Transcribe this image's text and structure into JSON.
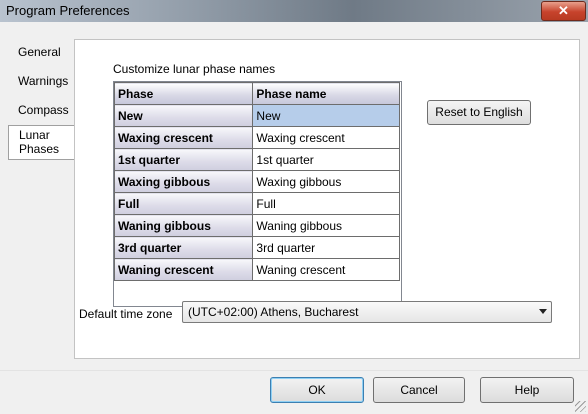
{
  "window": {
    "title": "Program Preferences",
    "close_glyph": "✕"
  },
  "tabs": [
    {
      "label": "General"
    },
    {
      "label": "Warnings"
    },
    {
      "label": "Compass"
    },
    {
      "label": "Lunar Phases",
      "active": true
    }
  ],
  "lunar": {
    "section_label": "Customize lunar phase names",
    "columns": [
      "Phase",
      "Phase name"
    ],
    "rows": [
      {
        "phase": "New",
        "name": "New"
      },
      {
        "phase": "Waxing crescent",
        "name": "Waxing crescent"
      },
      {
        "phase": "1st quarter",
        "name": "1st quarter"
      },
      {
        "phase": "Waxing gibbous",
        "name": "Waxing gibbous"
      },
      {
        "phase": "Full",
        "name": "Full"
      },
      {
        "phase": "Waning gibbous",
        "name": "Waning gibbous"
      },
      {
        "phase": "3rd quarter",
        "name": "3rd quarter"
      },
      {
        "phase": "Waning crescent",
        "name": "Waning crescent"
      }
    ],
    "selected_row": 0,
    "reset_label": "Reset to English"
  },
  "timezone": {
    "label": "Default time zone",
    "value": "(UTC+02:00) Athens, Bucharest"
  },
  "buttons": {
    "ok": "OK",
    "cancel": "Cancel",
    "help": "Help"
  }
}
